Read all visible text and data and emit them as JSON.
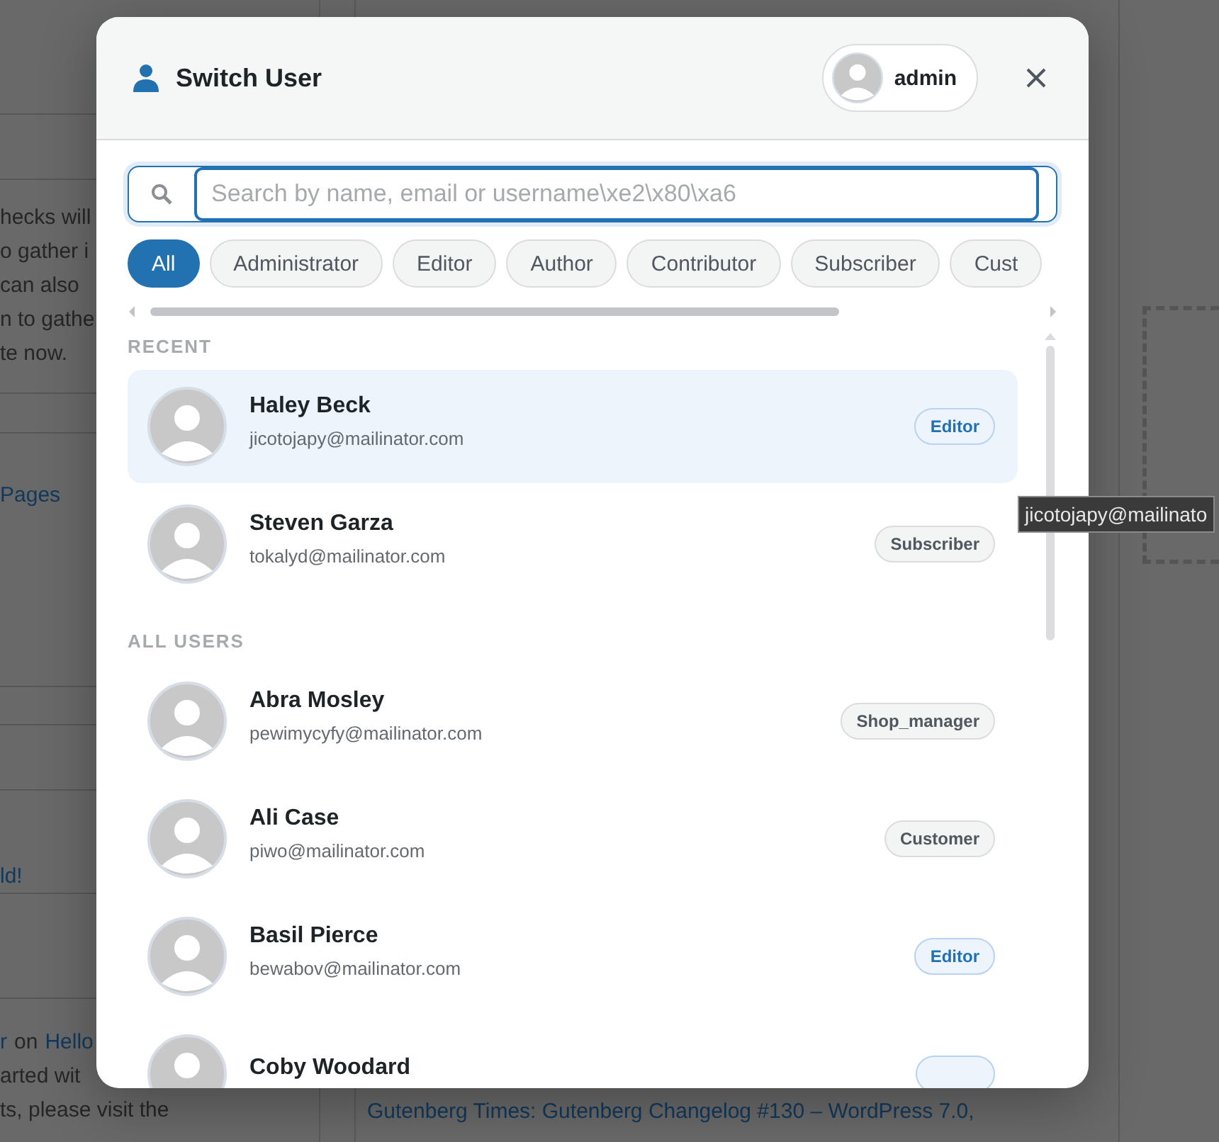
{
  "background": {
    "left_text": [
      "hecks will",
      "o gather i",
      "can also",
      "n to gathe",
      "te now."
    ],
    "pages_link": "Pages",
    "hello_link": "ld!",
    "comment_line": [
      {
        "text": "r",
        "link": true
      },
      {
        "text": "on",
        "link": false
      },
      {
        "text": "Hello",
        "link": true
      }
    ],
    "comment_text": [
      "arted wit",
      "ts, please visit the"
    ],
    "news": [
      "Gutenberg Times: Gutenberg Changelog #130 – WordPress 7.0,"
    ]
  },
  "dialog": {
    "title": "Switch User",
    "current_user": "admin",
    "search": {
      "placeholder": "Search by name, email or username\\xe2\\x80\\xa6"
    },
    "filters": [
      {
        "label": "All",
        "selected": true
      },
      {
        "label": "Administrator",
        "selected": false
      },
      {
        "label": "Editor",
        "selected": false
      },
      {
        "label": "Author",
        "selected": false
      },
      {
        "label": "Contributor",
        "selected": false
      },
      {
        "label": "Subscriber",
        "selected": false
      },
      {
        "label": "Cust",
        "selected": false
      }
    ],
    "sections": [
      {
        "heading": "RECENT",
        "users": [
          {
            "name": "Haley Beck",
            "email": "jicotojapy@mailinator.com",
            "role": "Editor",
            "kind": "highlight",
            "selected": true
          },
          {
            "name": "Steven Garza",
            "email": "tokalyd@mailinator.com",
            "role": "Subscriber",
            "kind": "plain",
            "selected": false
          }
        ]
      },
      {
        "heading": "ALL USERS",
        "users": [
          {
            "name": "Abra Mosley",
            "email": "pewimycyfy@mailinator.com",
            "role": "Shop_manager",
            "kind": "plain",
            "selected": false
          },
          {
            "name": "Ali Case",
            "email": "piwo@mailinator.com",
            "role": "Customer",
            "kind": "plain",
            "selected": false
          },
          {
            "name": "Basil Pierce",
            "email": "bewabov@mailinator.com",
            "role": "Editor",
            "kind": "highlight",
            "selected": false
          },
          {
            "name": "Coby Woodard",
            "kind": "highlight",
            "selected": false
          }
        ]
      }
    ]
  },
  "tooltip": "jicotojapy@mailinato"
}
